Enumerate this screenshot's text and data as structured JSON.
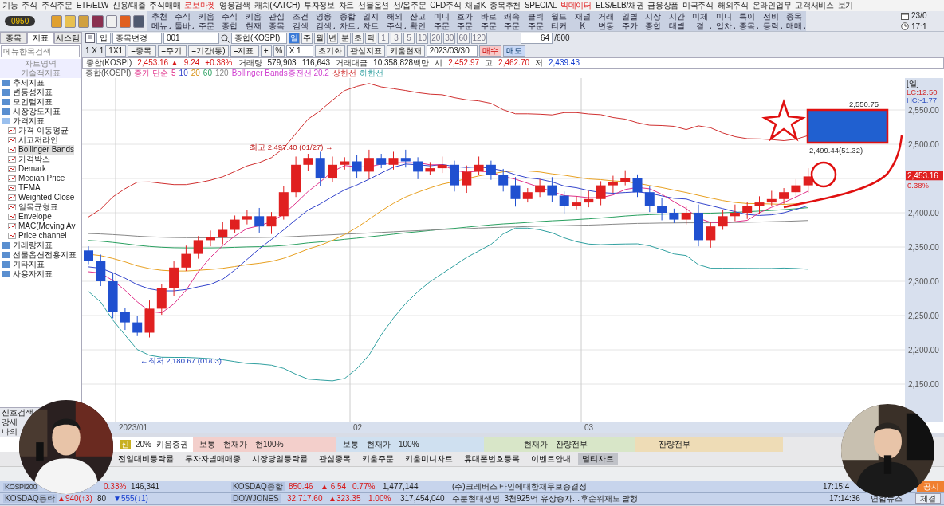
{
  "menu": [
    {
      "label": "기능",
      "highlight": false
    },
    {
      "label": "주식",
      "highlight": false
    },
    {
      "label": "주식주문",
      "highlight": false
    },
    {
      "label": "ETF/ELW",
      "highlight": false
    },
    {
      "label": "신용/대출",
      "highlight": false
    },
    {
      "label": "주식매매",
      "highlight": false
    },
    {
      "label": "로보마켓",
      "highlight": true
    },
    {
      "label": "영웅검색",
      "highlight": false
    },
    {
      "label": "캐치(KATCH)",
      "highlight": false
    },
    {
      "label": "투자정보",
      "highlight": false
    },
    {
      "label": "차트",
      "highlight": false
    },
    {
      "label": "선물옵션",
      "highlight": false
    },
    {
      "label": "선/옵주문",
      "highlight": false
    },
    {
      "label": "CFD주식",
      "highlight": false
    },
    {
      "label": "채널K",
      "highlight": false
    },
    {
      "label": "종목추천",
      "highlight": false
    },
    {
      "label": "SPECIAL",
      "highlight": false
    },
    {
      "label": "빅데이터",
      "highlight": true
    },
    {
      "label": "ELS/ELB/채권",
      "highlight": false
    },
    {
      "label": "금융상품",
      "highlight": false
    },
    {
      "label": "미국주식",
      "highlight": false
    },
    {
      "label": "해외주식",
      "highlight": false
    },
    {
      "label": "온라인업무",
      "highlight": false
    },
    {
      "label": "고객서비스",
      "highlight": false
    },
    {
      "label": "보기",
      "highlight": false
    }
  ],
  "clock_widget": {
    "time": "0950"
  },
  "toolbar_buttons": [
    {
      "top": "추천",
      "bottom": "메뉴",
      "dropdown": true
    },
    {
      "top": "주식",
      "bottom": "툴바",
      "dropdown": true
    },
    {
      "top": "키움",
      "bottom": "주문",
      "dropdown": false
    },
    {
      "top": "주식",
      "bottom": "종합",
      "dropdown": false
    },
    {
      "top": "키움",
      "bottom": "현재",
      "dropdown": false
    },
    {
      "top": "관심",
      "bottom": "종목",
      "dropdown": false
    },
    {
      "top": "조건",
      "bottom": "검색",
      "dropdown": false
    },
    {
      "top": "영웅",
      "bottom": "검색",
      "dropdown": true
    },
    {
      "top": "종합",
      "bottom": "차트",
      "dropdown": true
    },
    {
      "top": "일지",
      "bottom": "차트",
      "dropdown": false
    },
    {
      "top": "해외",
      "bottom": "주식",
      "dropdown": true
    },
    {
      "top": "잔고",
      "bottom": "확인",
      "dropdown": false
    },
    {
      "top": "미니",
      "bottom": "주문",
      "dropdown": false
    },
    {
      "top": "호가",
      "bottom": "주문",
      "dropdown": false
    },
    {
      "top": "바로",
      "bottom": "주문",
      "dropdown": false
    },
    {
      "top": "쾌속",
      "bottom": "주문",
      "dropdown": false
    },
    {
      "top": "클릭",
      "bottom": "주문",
      "dropdown": false
    },
    {
      "top": "월드",
      "bottom": "티커",
      "dropdown": false
    },
    {
      "top": "채널",
      "bottom": "K",
      "dropdown": false
    },
    {
      "top": "거래",
      "bottom": "변동",
      "dropdown": false
    },
    {
      "top": "일별",
      "bottom": "주가",
      "dropdown": false
    },
    {
      "top": "시장",
      "bottom": "종합",
      "dropdown": false
    },
    {
      "top": "시간",
      "bottom": "대별",
      "dropdown": false
    },
    {
      "top": "미체",
      "bottom": "결",
      "dropdown": true
    },
    {
      "top": "미니",
      "bottom": "업차",
      "dropdown": true
    },
    {
      "top": "특이",
      "bottom": "종목",
      "dropdown": true
    },
    {
      "top": "전비",
      "bottom": "등락",
      "dropdown": true
    },
    {
      "top": "종목",
      "bottom": "매매",
      "dropdown": true
    }
  ],
  "datetime": {
    "date": "23/0",
    "time": "17:1"
  },
  "left_panel": {
    "tabs": [
      {
        "label": "종목",
        "selected": false
      },
      {
        "label": "지표",
        "selected": true
      },
      {
        "label": "시스템",
        "selected": false
      }
    ],
    "search": {
      "placeholder": "메뉴한목검색"
    },
    "headers": [
      "차트영역",
      "기술적지표"
    ],
    "tree": [
      {
        "label": "추세지표",
        "expanded": false
      },
      {
        "label": "변동성지표",
        "expanded": false
      },
      {
        "label": "모멘텀지표",
        "expanded": false
      },
      {
        "label": "시장강도지표",
        "expanded": false
      },
      {
        "label": "가격지표",
        "expanded": true,
        "children": [
          {
            "label": "가격 이동평균",
            "selected": false
          },
          {
            "label": "시고저라인",
            "selected": false
          },
          {
            "label": "Bollinger Bands",
            "selected": true
          },
          {
            "label": "가격박스",
            "selected": false
          },
          {
            "label": "Demark",
            "selected": false
          },
          {
            "label": "Median Price",
            "selected": false
          },
          {
            "label": "TEMA",
            "selected": false
          },
          {
            "label": "Weighted Close",
            "selected": false
          },
          {
            "label": "일목균형표",
            "selected": false
          },
          {
            "label": "Envelope",
            "selected": false
          },
          {
            "label": "MAC(Moving Av",
            "selected": false
          },
          {
            "label": "Price channel",
            "selected": false
          }
        ]
      },
      {
        "label": "거래량지표",
        "expanded": false
      },
      {
        "label": "선물옵션전용지표",
        "expanded": false
      },
      {
        "label": "기타지표",
        "expanded": false
      },
      {
        "label": "사용자지표",
        "expanded": false
      }
    ],
    "bottom_items": [
      "신호검색",
      "강세",
      "나의"
    ]
  },
  "chart_toolbar": {
    "market": "업",
    "stock_change": "종목변경",
    "code": "001",
    "name": "종합(KOSPI)",
    "periods": [
      {
        "label": "일",
        "selected": true
      },
      {
        "label": "주",
        "selected": false
      },
      {
        "label": "월",
        "selected": false
      },
      {
        "label": "년",
        "selected": false
      },
      {
        "label": "분",
        "selected": false
      },
      {
        "label": "초",
        "selected": false
      },
      {
        "label": "틱",
        "selected": false
      }
    ],
    "intervals": [
      "1",
      "3",
      "5",
      "10",
      "20",
      "30",
      "60",
      "120"
    ],
    "count": "64",
    "max": "/600",
    "layout": "1 X 1",
    "layout_button": "1X1",
    "link_buttons": [
      "=종목",
      "=주기",
      "=기간(통)",
      "=지표"
    ],
    "tools": [
      "+",
      "%"
    ],
    "multiplier": "X 1",
    "actions": [
      "초기화",
      "관심지표",
      "키움현재"
    ],
    "date": "2023/03/30",
    "buy": "매수",
    "sell": "매도"
  },
  "info_row": [
    {
      "text": "종합(KOSPI)",
      "kind": "label"
    },
    {
      "text": "2,453.16 ▲",
      "kind": "up"
    },
    {
      "text": "9.24",
      "kind": "up"
    },
    {
      "text": "+0.38%",
      "kind": "up"
    },
    {
      "text": "거래량",
      "kind": "label"
    },
    {
      "text": "579,903",
      "kind": "plain"
    },
    {
      "text": "116,643",
      "kind": "plain"
    },
    {
      "text": "거래대금",
      "kind": "label"
    },
    {
      "text": "10,358,828백만",
      "kind": "plain"
    },
    {
      "text": "시",
      "kind": "label"
    },
    {
      "text": "2,452.97",
      "kind": "up"
    },
    {
      "text": "고",
      "kind": "label"
    },
    {
      "text": "2,462.70",
      "kind": "up"
    },
    {
      "text": "저",
      "kind": "label"
    },
    {
      "text": "2,439.43",
      "kind": "down"
    }
  ],
  "legend": [
    "종합(KOSPI)",
    "종가 단순",
    "5",
    "10",
    "20",
    "60",
    "120",
    "Bollinger Bands종전선 20.2",
    "상한선",
    "하한선"
  ],
  "chart": {
    "header": "[엘]",
    "lc": "LC:12.50",
    "hc": "HC:-1.77",
    "price_tag": "2,453.16",
    "change_tag": "0.38%",
    "y_labels": [
      "2,550.00",
      "2,500.00",
      "2,400.00",
      "2,350.00",
      "2,300.00",
      "2,250.00",
      "2,200.00",
      "2,150.00"
    ],
    "x_labels": [
      "2023/01",
      "02",
      "03"
    ],
    "annotations": [
      {
        "kind": "high",
        "text": "최고 2,497.40 (01/27) →"
      },
      {
        "kind": "low",
        "text": "←최저 2,180.67 (01/03)"
      },
      {
        "kind": "box_top",
        "text": "2,550.75"
      },
      {
        "kind": "box_bottom",
        "text": "2,499.44(51.32)"
      }
    ]
  },
  "order_bar": [
    {
      "kind": "account",
      "texts": [
        "신",
        "20%",
        "키움증권"
      ]
    },
    {
      "kind": "buy",
      "texts": [
        "보통",
        "현재가",
        "현100%"
      ]
    },
    {
      "kind": "sell",
      "texts": [
        "보통",
        "현재가",
        "100%"
      ]
    },
    {
      "kind": "modify",
      "texts": [
        "현재가",
        "잔량전부"
      ]
    },
    {
      "kind": "cancel",
      "texts": [
        "잔량전부"
      ]
    }
  ],
  "window_tabs": [
    {
      "label": "전일대비등락률",
      "selected": false
    },
    {
      "label": "투자자별매매종",
      "selected": false
    },
    {
      "label": "시장당일등락률",
      "selected": false
    },
    {
      "label": "관심종목",
      "selected": false
    },
    {
      "label": "키움주문",
      "selected": false
    },
    {
      "label": "키움미니차트",
      "selected": false
    },
    {
      "label": "휴대폰번호등록",
      "selected": false
    },
    {
      "label": "이벤트안내",
      "selected": false
    },
    {
      "label": "멀티차트",
      "selected": true
    }
  ],
  "ticker_rows": [
    {
      "cells": [
        {
          "text": "KOSPI200",
          "kind": "label"
        },
        {
          "text": "0.33%",
          "kind": "up"
        },
        {
          "text": "146,341",
          "kind": "plain"
        },
        {
          "text": "KOSDAQ종합",
          "kind": "label"
        },
        {
          "text": "850.46",
          "kind": "up"
        },
        {
          "text": "▲ 6.54",
          "kind": "up"
        },
        {
          "text": "0.77%",
          "kind": "up"
        },
        {
          "text": "1,477,144",
          "kind": "plain"
        },
        {
          "text": "(주)크레버스 타인에대한채무보증결정",
          "kind": "news"
        },
        {
          "text": "17:15:4",
          "kind": "plain"
        },
        {
          "text": "공시",
          "kind": "badge"
        }
      ]
    },
    {
      "cells": [
        {
          "text": "KOSDAQ등락",
          "kind": "label"
        },
        {
          "text": "▲940(↑3)",
          "kind": "up"
        },
        {
          "text": "80",
          "kind": "plain"
        },
        {
          "text": "▼555(↓1)",
          "kind": "down"
        },
        {
          "text": "DOWJONES",
          "kind": "label"
        },
        {
          "text": "32,717.60",
          "kind": "up"
        },
        {
          "text": "▲323.35",
          "kind": "up"
        },
        {
          "text": "1.00%",
          "kind": "up"
        },
        {
          "text": "317,454,040",
          "kind": "plain"
        },
        {
          "text": "주분현대생명, 3천925억 유상증자…후순위채도 발행",
          "kind": "news"
        },
        {
          "text": "17:14:36",
          "kind": "plain"
        },
        {
          "text": "연합뉴스",
          "kind": "plain"
        },
        {
          "text": "체결",
          "kind": "button"
        }
      ]
    }
  ],
  "presenters": [
    {
      "kind": "picture"
    },
    {
      "kind": "picture"
    }
  ]
}
